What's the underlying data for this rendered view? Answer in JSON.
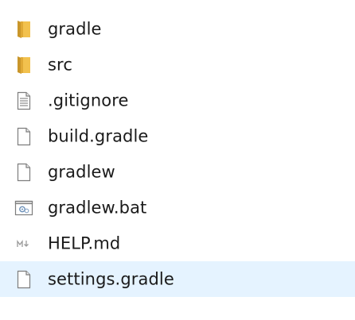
{
  "explorer": {
    "items": [
      {
        "name": "gradle",
        "icon": "folder-icon",
        "selected": false
      },
      {
        "name": "src",
        "icon": "folder-icon",
        "selected": false
      },
      {
        "name": ".gitignore",
        "icon": "text-document-icon",
        "selected": false
      },
      {
        "name": "build.gradle",
        "icon": "blank-file-icon",
        "selected": false
      },
      {
        "name": "gradlew",
        "icon": "blank-file-icon",
        "selected": false
      },
      {
        "name": "gradlew.bat",
        "icon": "batch-file-icon",
        "selected": false
      },
      {
        "name": "HELP.md",
        "icon": "markdown-file-icon",
        "selected": false
      },
      {
        "name": "settings.gradle",
        "icon": "blank-file-icon",
        "selected": true
      }
    ],
    "colors": {
      "folder": "#e8b63a",
      "selection": "#e5f3ff",
      "text": "#1a1a1a"
    }
  }
}
